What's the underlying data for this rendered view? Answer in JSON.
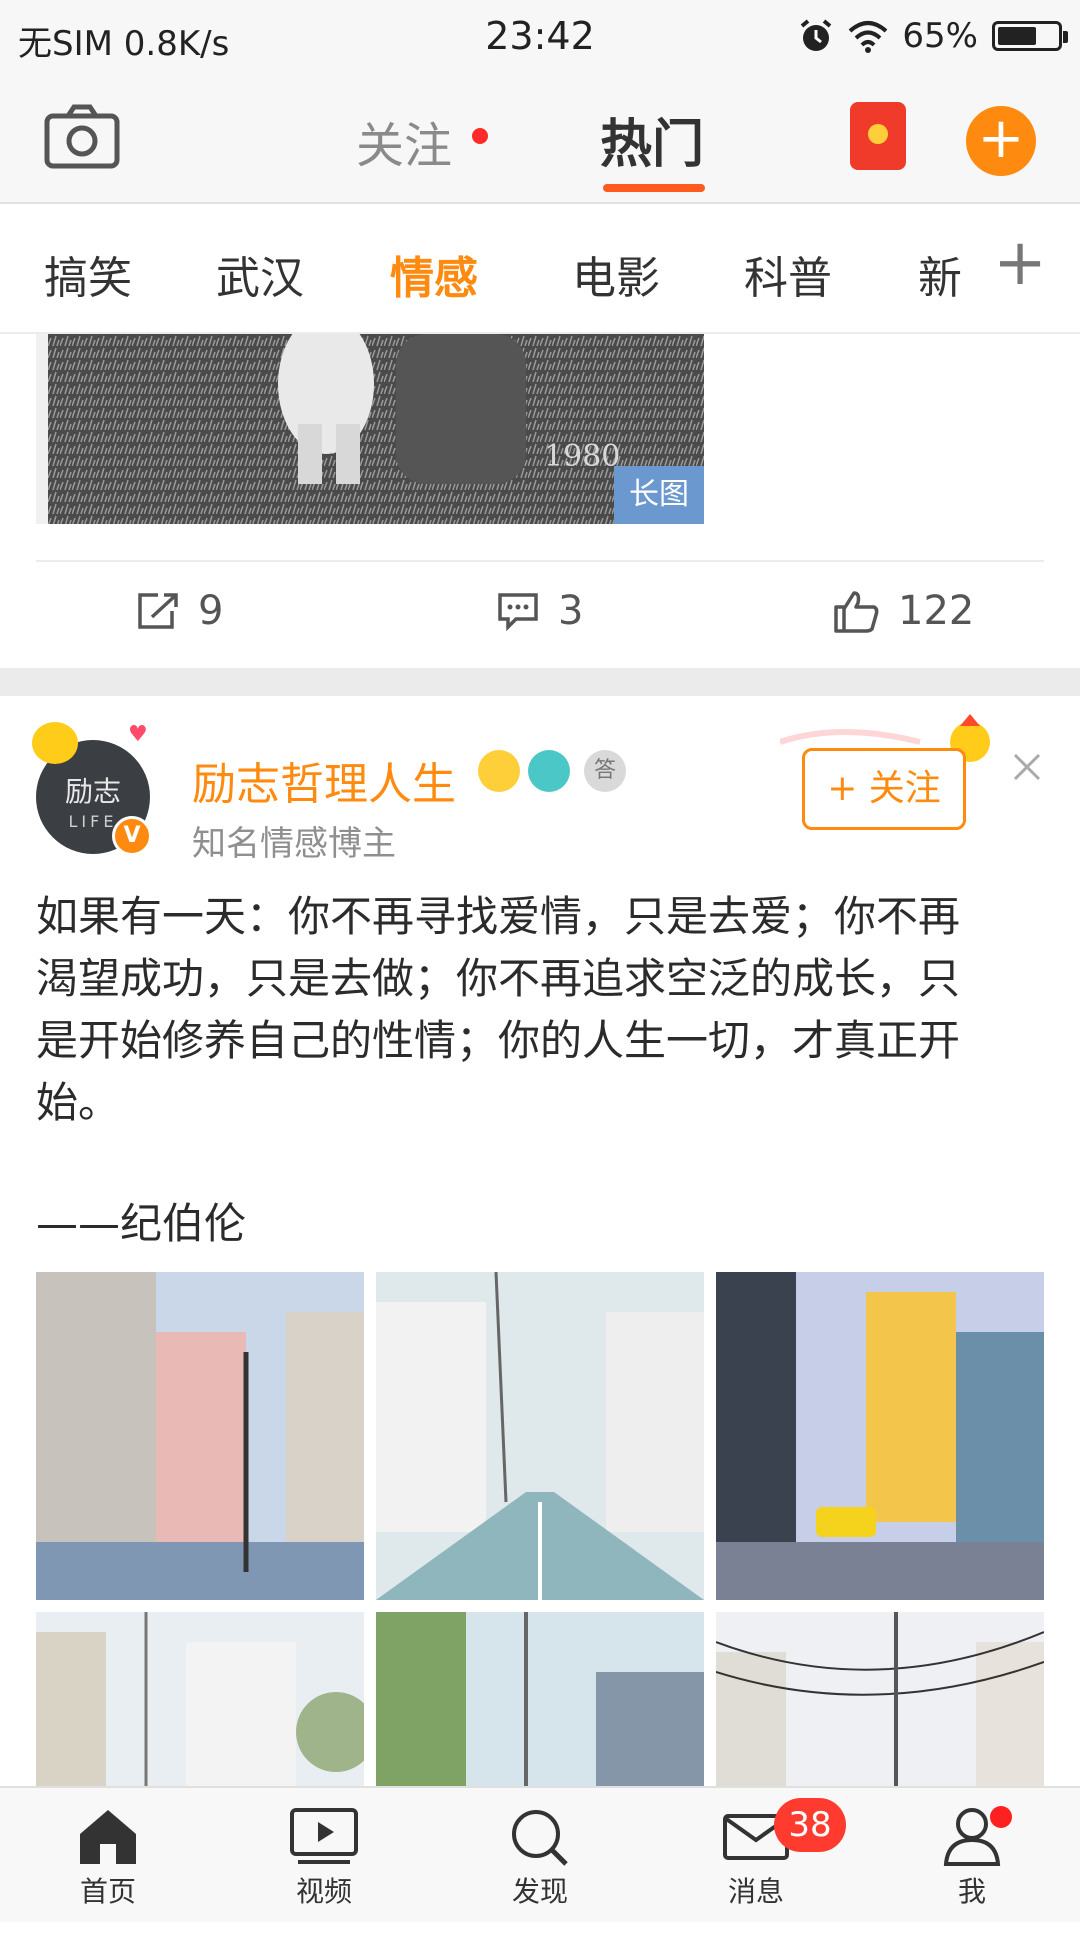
{
  "status_bar": {
    "carrier": "无SIM",
    "speed": "0.8K/s",
    "time": "23:42",
    "battery": "65%",
    "battery_level": 0.65
  },
  "top_nav": {
    "tabs": [
      {
        "label": "关注",
        "has_dot": true
      },
      {
        "label": "热门",
        "active": true
      }
    ],
    "icons": [
      "camera-icon",
      "red-packet-icon",
      "compose-plus-icon"
    ],
    "accent_color": "#ff8a10",
    "underline_color": "#ff5b1f"
  },
  "categories": {
    "items": [
      "搞笑",
      "武汉",
      "情感",
      "电影",
      "科普",
      "新"
    ],
    "active": "情感",
    "add_label": "+"
  },
  "prev_post": {
    "image_tag": "长图",
    "photo_text": "1980",
    "actions": [
      {
        "icon": "repost-icon",
        "count": "9"
      },
      {
        "icon": "comment-icon",
        "count": "3"
      },
      {
        "icon": "like-icon",
        "count": "122"
      }
    ]
  },
  "post": {
    "avatar_text": "励志",
    "avatar_sub": "LIFE",
    "verify_mark": "V",
    "username": "励志哲理人生",
    "medal_char": "答",
    "description": "知名情感博主",
    "follow_label": "+ 关注",
    "lines": [
      "如果有一天：你不再寻找爱情，只是去爱；你不再",
      "渴望成功，只是去做；你不再追求空泛的成长，只",
      "是开始修养自己的性情；你的人生一切，才真正开",
      "始。"
    ],
    "signature": "——纪伯伦"
  },
  "bottom_tabs": [
    {
      "label": "首页",
      "icon": "home-icon"
    },
    {
      "label": "视频",
      "icon": "video-icon"
    },
    {
      "label": "发现",
      "icon": "search-icon"
    },
    {
      "label": "消息",
      "icon": "mail-icon"
    },
    {
      "label": "我",
      "icon": "profile-icon"
    }
  ],
  "message_badge": "38"
}
